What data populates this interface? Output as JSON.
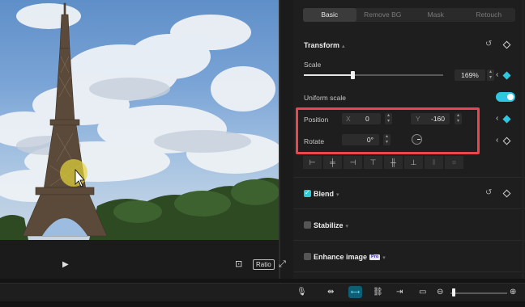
{
  "tabs": [
    {
      "label": "Basic",
      "active": true
    },
    {
      "label": "Remove BG",
      "active": false
    },
    {
      "label": "Mask",
      "active": false
    },
    {
      "label": "Retouch",
      "active": false
    }
  ],
  "transform": {
    "title": "Transform",
    "scale_label": "Scale",
    "scale_value": "169%",
    "scale_fraction": 0.35,
    "uniform_scale_label": "Uniform scale",
    "uniform_scale_on": true,
    "position_label": "Position",
    "x_label": "X",
    "x_value": "0",
    "y_label": "Y",
    "y_value": "-160",
    "rotate_label": "Rotate",
    "rotate_value": "0°"
  },
  "blend": {
    "label": "Blend",
    "checked": true
  },
  "stabilize": {
    "label": "Stabilize",
    "checked": false
  },
  "enhance": {
    "label": "Enhance image",
    "checked": false,
    "badge": "Pro"
  },
  "player": {
    "ratio_label": "Ratio"
  },
  "colors": {
    "accent": "#2ec7e0",
    "highlight": "#e8474f",
    "panel_bg": "#1e1e1e"
  },
  "toolbar_icons": [
    "microphone-icon",
    "link-icon",
    "auto-snap-icon",
    "chain-icon",
    "split-icon",
    "preview-icon",
    "zoom-out-icon",
    "zoom-in-icon"
  ],
  "zoom_level": 0.05
}
